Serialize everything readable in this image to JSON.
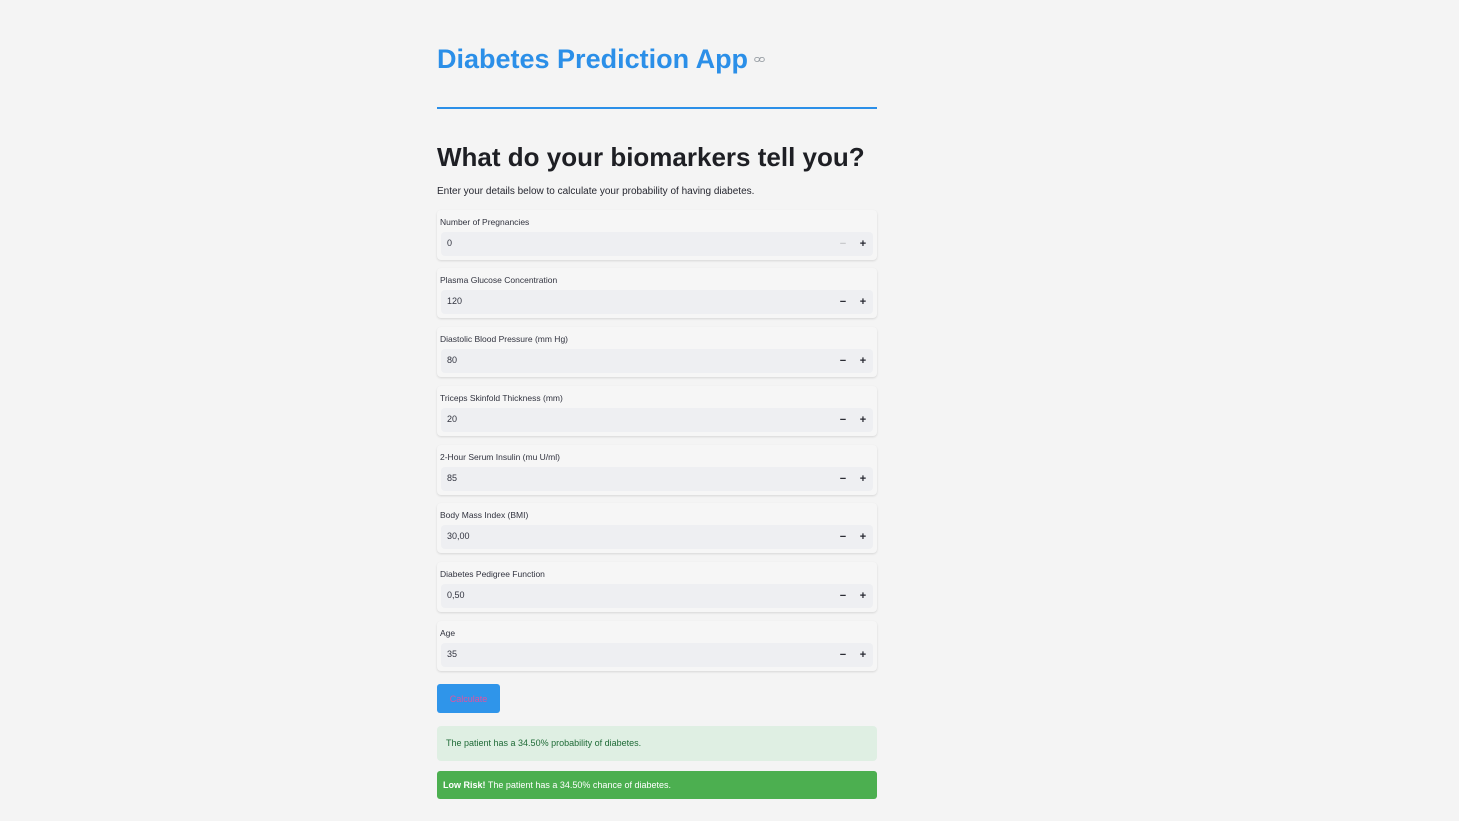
{
  "app": {
    "title": "Diabetes Prediction App"
  },
  "main": {
    "heading": "What do your biomarkers tell you?",
    "intro": "Enter your details below to calculate your probability of having diabetes."
  },
  "fields": [
    {
      "label": "Number of Pregnancies",
      "value": "0",
      "minus": "−",
      "plus": "+"
    },
    {
      "label": "Plasma Glucose Concentration",
      "value": "120",
      "minus": "−",
      "plus": "+"
    },
    {
      "label": "Diastolic Blood Pressure (mm Hg)",
      "value": "80",
      "minus": "−",
      "plus": "+"
    },
    {
      "label": "Triceps Skinfold Thickness (mm)",
      "value": "20",
      "minus": "−",
      "plus": "+"
    },
    {
      "label": "2-Hour Serum Insulin (mu U/ml)",
      "value": "85",
      "minus": "−",
      "plus": "+"
    },
    {
      "label": "Body Mass Index (BMI)",
      "value": "30,00",
      "minus": "−",
      "plus": "+"
    },
    {
      "label": "Diabetes Pedigree Function",
      "value": "0,50",
      "minus": "−",
      "plus": "+"
    },
    {
      "label": "Age",
      "value": "35",
      "minus": "−",
      "plus": "+"
    }
  ],
  "actions": {
    "calculate_label": "Calculate"
  },
  "results": {
    "probability_text": "The patient has a 34.50% probability of diabetes.",
    "risk_label": "Low Risk!",
    "risk_text": " The patient has a 34.50% chance of diabetes."
  },
  "colors": {
    "accent": "#2b8fe8",
    "success": "#4caf50"
  }
}
